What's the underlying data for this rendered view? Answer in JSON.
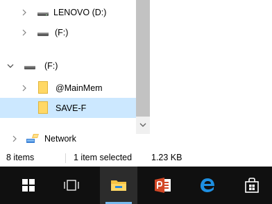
{
  "nav_tree": {
    "items": [
      {
        "label": "LENOVO (D:)",
        "icon": "drive-icon",
        "expanded": false
      },
      {
        "label": "(F:)",
        "icon": "drive-icon",
        "expanded": false
      },
      {
        "label": "(F:)",
        "icon": "drive-icon",
        "expanded": true
      },
      {
        "label": "@MainMem",
        "icon": "folder-icon",
        "expanded": false
      },
      {
        "label": "SAVE-F",
        "icon": "folder-icon",
        "selected": true
      },
      {
        "label": "Network",
        "icon": "network-icon",
        "expanded": false
      }
    ]
  },
  "status_bar": {
    "item_count": "8 items",
    "selection": "1 item selected",
    "size": "1.23 KB"
  },
  "taskbar": {
    "buttons": [
      "start-icon",
      "task-view-icon",
      "file-explorer-icon",
      "powerpoint-icon",
      "edge-icon",
      "store-icon"
    ],
    "active": "file-explorer-icon"
  },
  "colors": {
    "selection": "#cce8ff",
    "taskbar": "#101010",
    "accent": "#0078d7",
    "folder": "#ffd866"
  }
}
